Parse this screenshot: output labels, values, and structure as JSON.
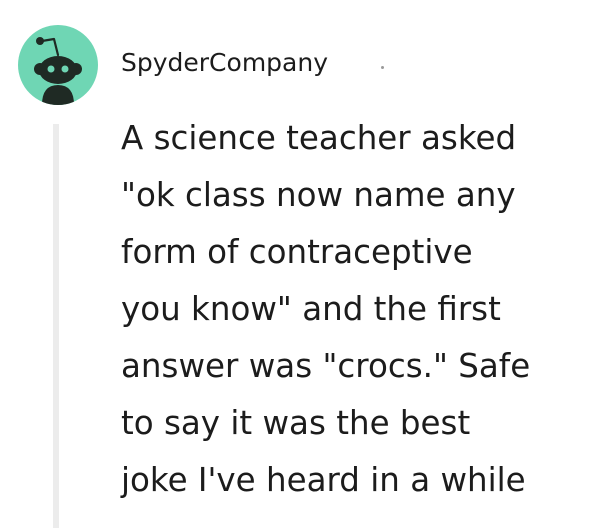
{
  "comment": {
    "username": "SpyderCompany",
    "separator": "·",
    "avatar_icon": "snoo-avatar-icon",
    "avatar_color": "#6fd6b4",
    "body_lines": [
      "A science teacher asked",
      "\"ok class now name any",
      "form of contraceptive",
      "you know\" and the first",
      "answer was \"crocs.\" Safe",
      "to say it was the best",
      "joke I've heard in a while"
    ]
  }
}
